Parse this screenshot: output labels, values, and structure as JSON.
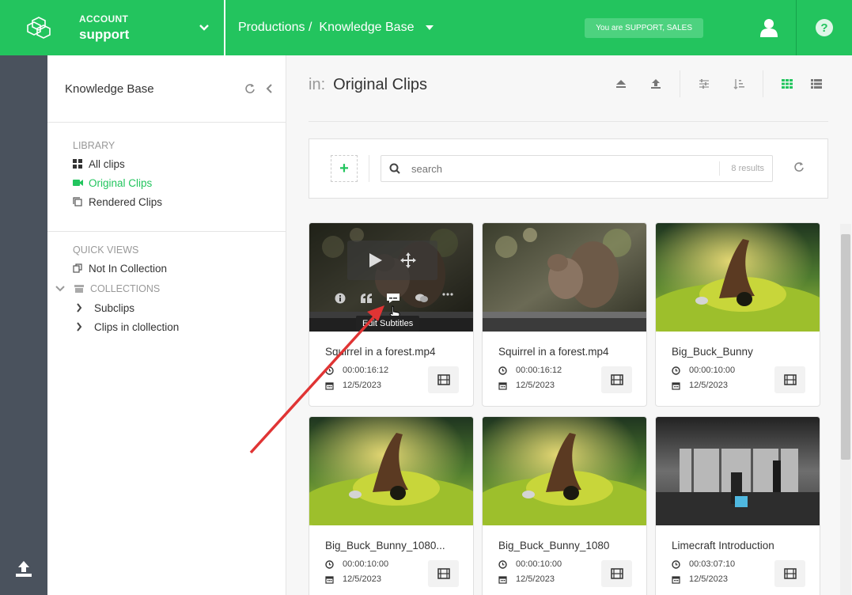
{
  "header": {
    "account_label": "ACCOUNT",
    "account_name": "support",
    "breadcrumb_root": "Productions /",
    "breadcrumb_current": "Knowledge Base",
    "role_badge": "You are SUPPORT, SALES",
    "brand_color": "#23c45e"
  },
  "sidebar": {
    "title": "Knowledge Base",
    "library_title": "LIBRARY",
    "library_items": [
      {
        "label": "All clips",
        "icon": "grid-icon"
      },
      {
        "label": "Original Clips",
        "icon": "video-camera-icon",
        "active": true
      },
      {
        "label": "Rendered Clips",
        "icon": "copy-icon"
      }
    ],
    "quick_views_title": "QUICK VIEWS",
    "quick_views": [
      {
        "label": "Not In Collection",
        "icon": "unlinked-icon"
      }
    ],
    "collections_title": "COLLECTIONS",
    "collections": [
      {
        "label": "Subclips"
      },
      {
        "label": "Clips in clollection"
      }
    ]
  },
  "main": {
    "in_label": "in:",
    "title": "Original Clips",
    "search_placeholder": "search",
    "results_count": "8 results"
  },
  "clips": [
    {
      "name": "Squirrel in a forest.mp4",
      "duration": "00:00:16:12",
      "date": "12/5/2023",
      "thumb": "squirrel",
      "hovered": true
    },
    {
      "name": "Squirrel in a forest.mp4",
      "duration": "00:00:16:12",
      "date": "12/5/2023",
      "thumb": "squirrel"
    },
    {
      "name": "Big_Buck_Bunny",
      "duration": "00:00:10:00",
      "date": "12/5/2023",
      "thumb": "bunny"
    },
    {
      "name": "Big_Buck_Bunny_1080...",
      "duration": "00:00:10:00",
      "date": "12/5/2023",
      "thumb": "bunny"
    },
    {
      "name": "Big_Buck_Bunny_1080",
      "duration": "00:00:10:00",
      "date": "12/5/2023",
      "thumb": "bunny"
    },
    {
      "name": "Limecraft Introduction",
      "duration": "00:03:07:10",
      "date": "12/5/2023",
      "thumb": "bw-room"
    }
  ],
  "hover_tooltip": "Edit Subtitles"
}
